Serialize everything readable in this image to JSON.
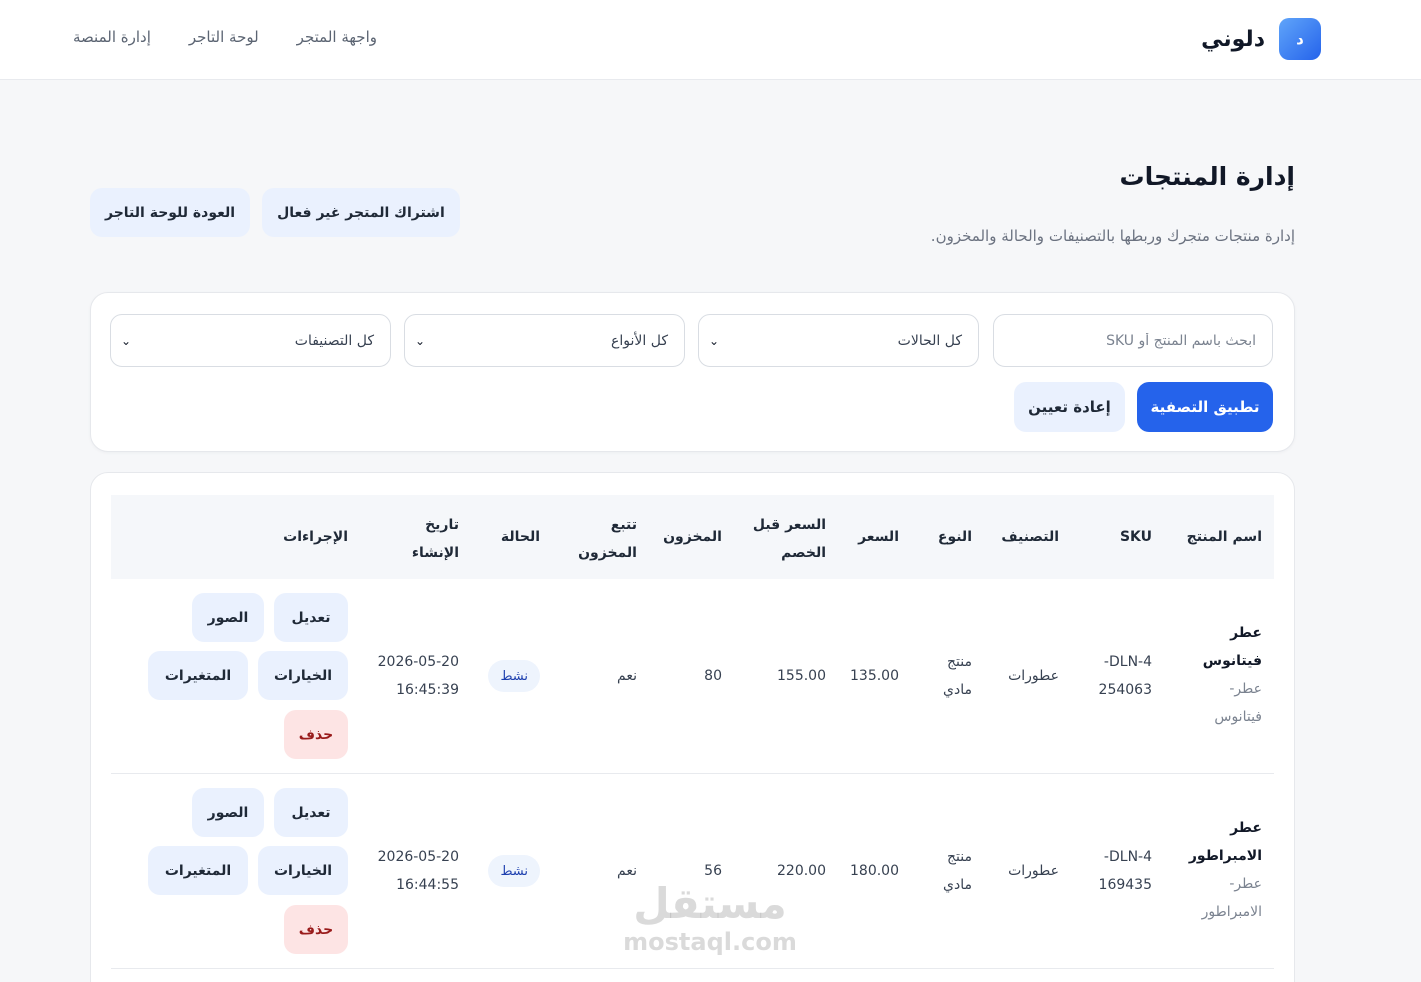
{
  "brand": {
    "logo_letter": "د",
    "name": "دلوني",
    "accent": "#2563eb"
  },
  "nav": {
    "items": [
      "إدارة المنصة",
      "لوحة التاجر",
      "واجهة المتجر"
    ]
  },
  "header": {
    "title": "إدارة المنتجات",
    "subtitle": "إدارة منتجات متجرك وربطها بالتصنيفات والحالة والمخزون.",
    "back_label": "العودة للوحة التاجر",
    "subscription_label": "اشتراك المتجر غير فعال"
  },
  "filters": {
    "search_placeholder": "ابحث باسم المنتج أو SKU",
    "status_value": "كل الحالات",
    "type_value": "كل الأنواع",
    "category_value": "كل التصنيفات",
    "apply_label": "تطبيق التصفية",
    "reset_label": "إعادة تعيين"
  },
  "table": {
    "columns": {
      "name": "اسم المنتج",
      "sku": "SKU",
      "category": "التصنيف",
      "type": "النوع",
      "price": "السعر",
      "compare_price_1": "السعر قبل",
      "compare_price_2": "الخصم",
      "stock": "المخزون",
      "track_1": "تتبع",
      "track_2": "المخزون",
      "status": "الحالة",
      "created_1": "تاريخ",
      "created_2": "الإنشاء",
      "actions": "الإجراءات"
    },
    "actions": {
      "edit": "تعديل",
      "images": "الصور",
      "options": "الخيارات",
      "variants": "المتغيرات",
      "delete": "حذف"
    },
    "rows": [
      {
        "name_1": "عطر",
        "name_2": "فيتانوس",
        "slug_1": "عطر-",
        "slug_2": "فيتانوس",
        "sku_1": "DLN-4-",
        "sku_2": "254063",
        "category": "عطورات",
        "type_1": "منتج",
        "type_2": "مادي",
        "price": "135.00",
        "compare_price": "155.00",
        "stock": "80",
        "track": "نعم",
        "status": "نشط",
        "date": "2026-05-20",
        "time": "16:45:39"
      },
      {
        "name_1": "عطر",
        "name_2": "الامبراطور",
        "slug_1": "عطر-",
        "slug_2": "الامبراطور",
        "sku_1": "DLN-4-",
        "sku_2": "169435",
        "category": "عطورات",
        "type_1": "منتج",
        "type_2": "مادي",
        "price": "180.00",
        "compare_price": "220.00",
        "stock": "56",
        "track": "نعم",
        "status": "نشط",
        "date": "2026-05-20",
        "time": "16:44:55"
      }
    ]
  },
  "watermark": {
    "line1": "مستقل",
    "line2": "mostaql.com"
  }
}
